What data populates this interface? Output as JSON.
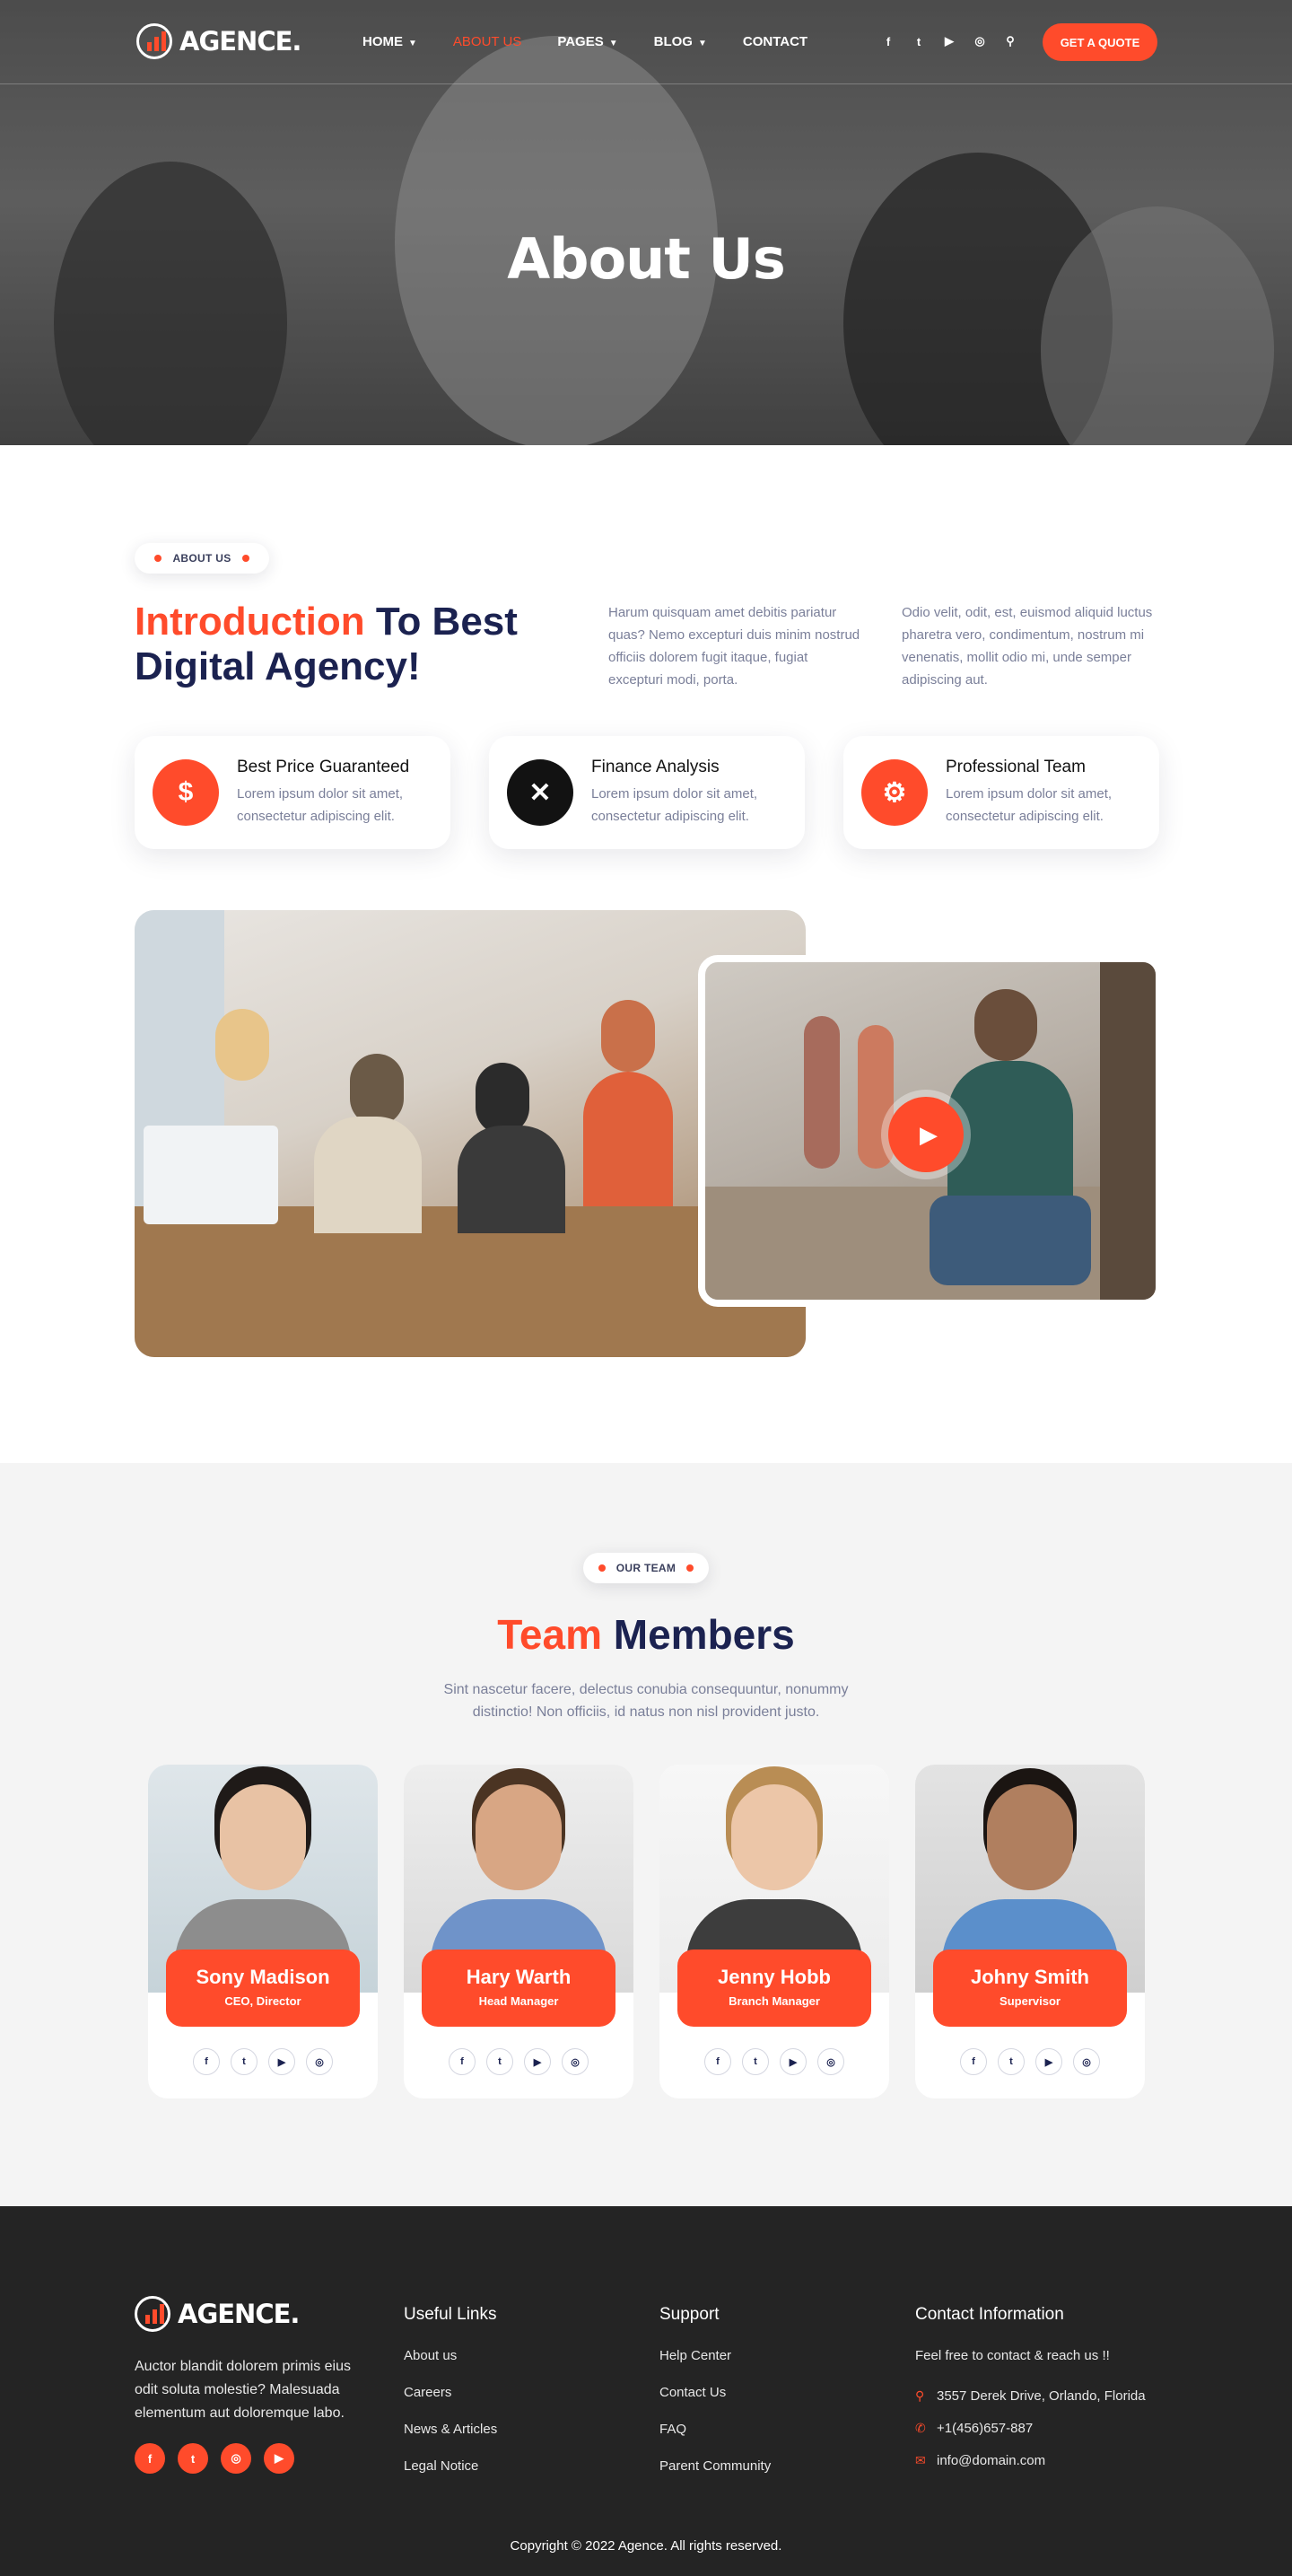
{
  "brand": {
    "name": "AGENCE.",
    "accent": "#ff4b2b",
    "navy": "#1b2250"
  },
  "nav": {
    "items": [
      {
        "label": "HOME",
        "caret": true
      },
      {
        "label": "ABOUT US",
        "caret": false,
        "active": true
      },
      {
        "label": "PAGES",
        "caret": true
      },
      {
        "label": "BLOG",
        "caret": true
      },
      {
        "label": "CONTACT",
        "caret": false
      }
    ],
    "social_icons": [
      "facebook-icon",
      "twitter-icon",
      "youtube-icon",
      "instagram-icon",
      "search-icon"
    ],
    "cta": "GET A QUOTE"
  },
  "hero": {
    "title": "About Us"
  },
  "about": {
    "pill": "ABOUT US",
    "title_highlight": "Introduction",
    "title_rest": " To Best Digital Agency!",
    "para1": "Harum quisquam amet debitis pariatur quas? Nemo excepturi duis minim nostrud officiis dolorem fugit itaque, fugiat excepturi modi, porta.",
    "para2": "Odio velit, odit, est, euismod aliquid luctus pharetra vero, condimentum, nostrum mi venenatis, mollit odio mi, unde semper adipiscing aut.",
    "features": [
      {
        "icon": "price-hand-icon",
        "title": "Best Price Guaranteed",
        "desc": "Lorem ipsum dolor sit amet, consectetur adipiscing elit."
      },
      {
        "icon": "tools-icon",
        "title": "Finance Analysis",
        "desc": "Lorem ipsum dolor sit amet, consectetur adipiscing elit."
      },
      {
        "icon": "team-gear-icon",
        "title": "Professional Team",
        "desc": "Lorem ipsum dolor sit amet, consectetur adipiscing elit."
      }
    ]
  },
  "team": {
    "pill": "OUR TEAM",
    "title_highlight": "Team",
    "title_rest": " Members",
    "subtitle": "Sint nascetur facere, delectus conubia consequuntur, nonummy distinctio! Non officiis, id natus non nisl provident justo.",
    "members": [
      {
        "name": "Sony Madison",
        "role": "CEO, Director"
      },
      {
        "name": "Hary Warth",
        "role": "Head Manager"
      },
      {
        "name": "Jenny Hobb",
        "role": "Branch Manager"
      },
      {
        "name": "Johny Smith",
        "role": "Supervisor"
      }
    ],
    "member_social_icons": [
      "facebook-icon",
      "twitter-icon",
      "youtube-icon",
      "instagram-icon"
    ]
  },
  "footer": {
    "logo": "AGENCE.",
    "about": "Auctor blandit dolorem primis eius odit soluta molestie? Malesuada elementum aut doloremque labo.",
    "social_icons": [
      "facebook-icon",
      "twitter-icon",
      "instagram-icon",
      "youtube-icon"
    ],
    "useful_links": {
      "title": "Useful Links",
      "items": [
        "About us",
        "Careers",
        "News & Articles",
        "Legal Notice"
      ]
    },
    "support": {
      "title": "Support",
      "items": [
        "Help Center",
        "Contact Us",
        "FAQ",
        "Parent Community"
      ]
    },
    "contact": {
      "title": "Contact Information",
      "lead": "Feel free to contact & reach us !!",
      "address": "3557 Derek Drive, Orlando, Florida",
      "phone": "+1(456)657-887",
      "email": "info@domain.com"
    },
    "copyright": "Copyright © 2022 Agence. All rights reserved."
  }
}
